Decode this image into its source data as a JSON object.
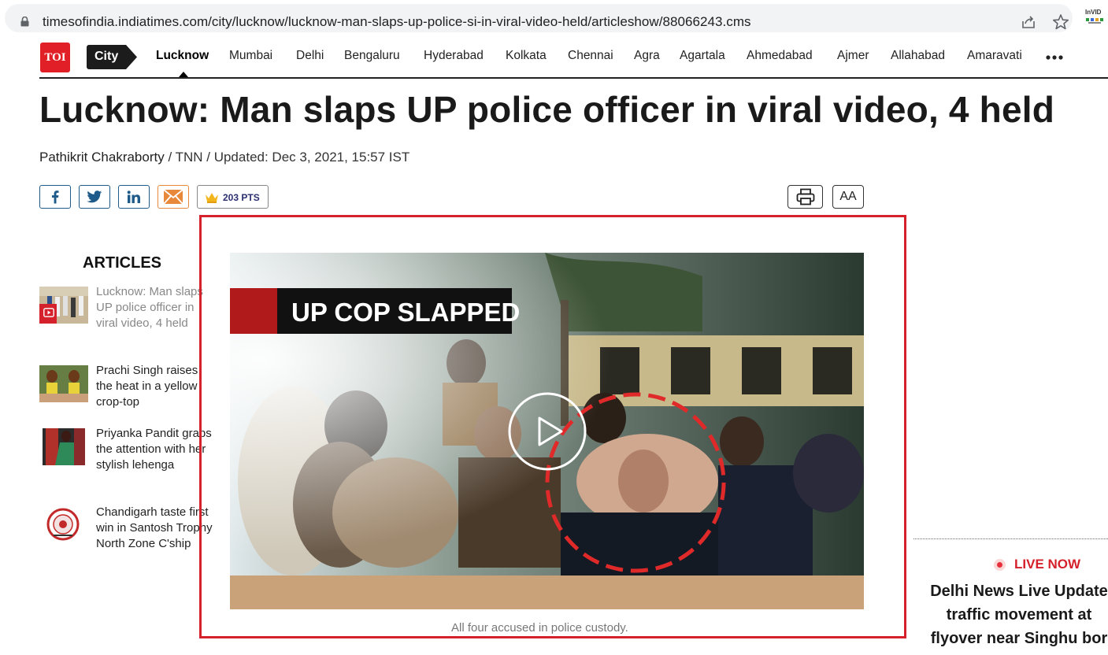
{
  "browser": {
    "url": "timesofindia.indiatimes.com/city/lucknow/lucknow-man-slaps-up-police-si-in-viral-video-held/articleshow/88066243.cms",
    "extension_label": "InVID"
  },
  "site": {
    "logo_text": "TOI",
    "section_tag": "City",
    "nav_items": [
      "Lucknow",
      "Mumbai",
      "Delhi",
      "Bengaluru",
      "Hyderabad",
      "Kolkata",
      "Chennai",
      "Agra",
      "Agartala",
      "Ahmedabad",
      "Ajmer",
      "Allahabad",
      "Amaravati"
    ],
    "active_nav": "Lucknow"
  },
  "article": {
    "headline": "Lucknow: Man slaps UP police officer in viral video, 4 held",
    "author": "Pathikrit Chakraborty",
    "byline_rest": " / TNN / Updated: Dec 3, 2021, 15:57 IST",
    "points": "203 PTS",
    "font_size_label": "AA"
  },
  "sidebar": {
    "title": "ARTICLES",
    "items": [
      {
        "title": "Lucknow: Man slaps UP police officer in viral video, 4 held"
      },
      {
        "title": "Prachi Singh raises the heat in a yellow crop-top"
      },
      {
        "title": "Priyanka Pandit grabs the attention with her stylish lehenga"
      },
      {
        "title": "Chandigarh taste first win in Santosh Trophy North Zone C'ship"
      }
    ]
  },
  "video": {
    "banner_text": "UP COP SLAPPED",
    "caption": "All four accused in police custody."
  },
  "live": {
    "label": "LIVE NOW",
    "headline_lines": [
      "Delhi News Live Update",
      "traffic movement at",
      "flyover near Singhu bor"
    ]
  },
  "colors": {
    "brand_red": "#e01f26",
    "frame_red": "#d4212c",
    "share_blue": "#1f5b8a",
    "mail_orange": "#e7883a"
  }
}
